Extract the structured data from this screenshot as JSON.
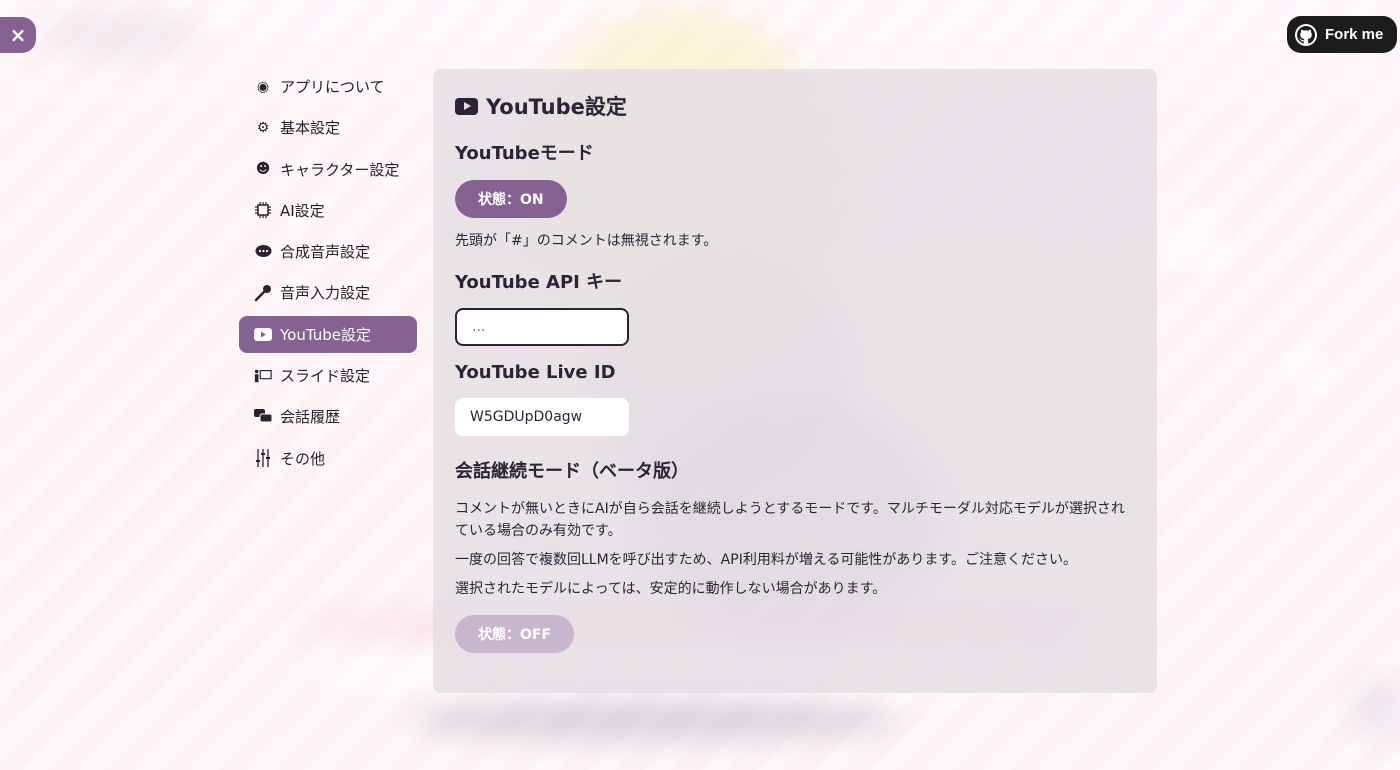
{
  "header": {
    "close_label": "×",
    "fork_label": "Fork me"
  },
  "sidebar": {
    "items": [
      {
        "label": "アプリについて",
        "icon": "info-circle-icon"
      },
      {
        "label": "基本設定",
        "icon": "gear-icon"
      },
      {
        "label": "キャラクター設定",
        "icon": "character-icon"
      },
      {
        "label": "AI設定",
        "icon": "ai-chip-icon"
      },
      {
        "label": "合成音声設定",
        "icon": "speech-bubble-icon"
      },
      {
        "label": "音声入力設定",
        "icon": "microphone-icon"
      },
      {
        "label": "YouTube設定",
        "icon": "youtube-icon",
        "active": true
      },
      {
        "label": "スライド設定",
        "icon": "presentation-icon"
      },
      {
        "label": "会話履歴",
        "icon": "chat-history-icon"
      },
      {
        "label": "その他",
        "icon": "sliders-icon"
      }
    ]
  },
  "main": {
    "title": "YouTube設定",
    "youtube_mode": {
      "heading": "YouTubeモード",
      "toggle_label": "状態：ON",
      "note": "先頭が「#」のコメントは無視されます。"
    },
    "api_key": {
      "heading": "YouTube API キー",
      "placeholder": "..."
    },
    "live_id": {
      "heading": "YouTube Live ID",
      "value": "W5GDUpD0agw"
    },
    "continuation": {
      "heading": "会話継続モード（ベータ版）",
      "desc1": "コメントが無いときにAIが自ら会話を継続しようとするモードです。マルチモーダル対応モデルが選択されている場合のみ有効です。",
      "desc2": "一度の回答で複数回LLMを呼び出すため、API利用料が増える可能性があります。ご注意ください。",
      "desc3": "選択されたモデルによっては、安定的に動作しない場合があります。",
      "toggle_label": "状態：OFF"
    }
  },
  "colors": {
    "accent": "#856292",
    "accent_disabled": "#c8b6cc"
  }
}
